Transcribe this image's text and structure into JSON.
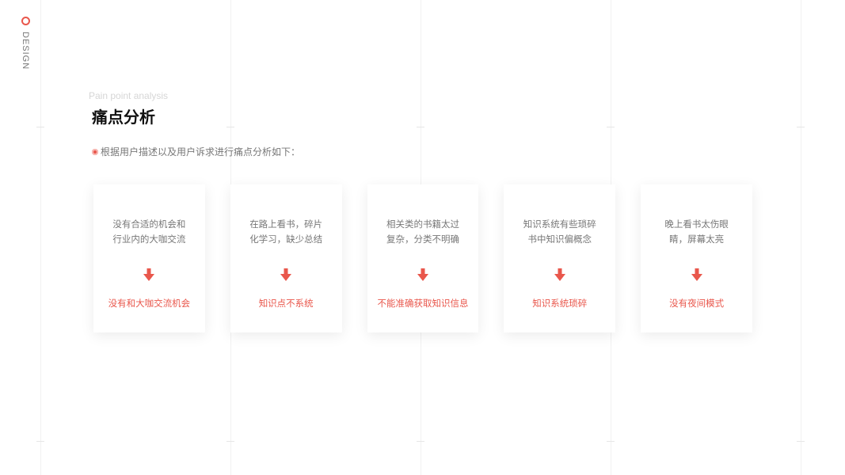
{
  "brand": {
    "label": "DESIGN",
    "accent_color": "#e9574c"
  },
  "header": {
    "subtitle_en": "Pain point analysis",
    "title": "痛点分析",
    "intro": "根据用户描述以及用户诉求进行痛点分析如下："
  },
  "cards": [
    {
      "problem_line1": "没有合适的机会和",
      "problem_line2": "行业内的大咖交流",
      "result": "没有和大咖交流机会"
    },
    {
      "problem_line1": "在路上看书，碎片",
      "problem_line2": "化学习，缺少总结",
      "result": "知识点不系统"
    },
    {
      "problem_line1": "相关类的书籍太过",
      "problem_line2": "复杂，分类不明确",
      "result": "不能准确获取知识信息"
    },
    {
      "problem_line1": "知识系统有些琐碎",
      "problem_line2": "书中知识偏概念",
      "result": "知识系统琐碎"
    },
    {
      "problem_line1": "晚上看书太伤眼",
      "problem_line2": "睛，屏幕太亮",
      "result": "没有夜间模式"
    }
  ],
  "icons": {
    "arrow": "arrow-down-icon",
    "bullet": "bullet-dot-icon",
    "brand": "ring-logo-icon"
  }
}
